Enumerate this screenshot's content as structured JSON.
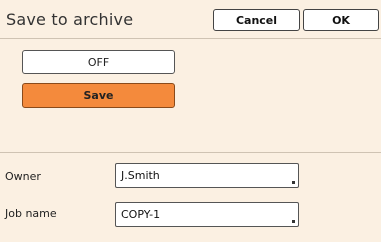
{
  "header": {
    "title": "Save to archive",
    "cancel_label": "Cancel",
    "ok_label": "OK"
  },
  "options": {
    "off_label": "OFF",
    "save_label": "Save",
    "selected": "Save"
  },
  "form": {
    "owner_label": "Owner",
    "owner_value": "J.Smith",
    "job_name_label": "Job name",
    "job_name_value": "COPY-1"
  },
  "colors": {
    "background": "#fbf0e2",
    "selected_button": "#f48a3c"
  }
}
